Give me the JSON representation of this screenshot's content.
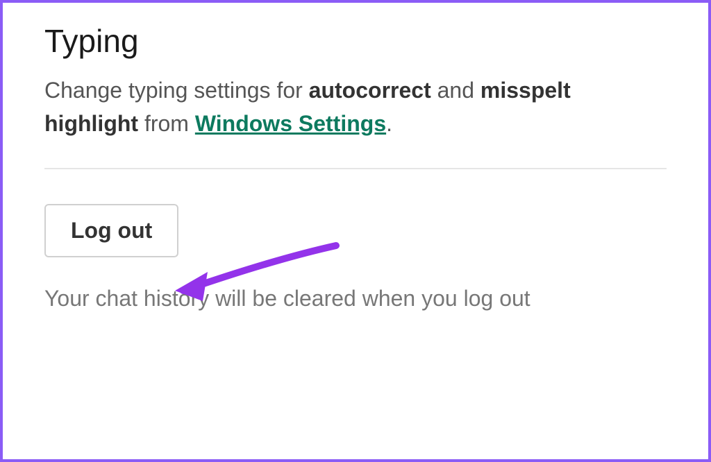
{
  "typing": {
    "title": "Typing",
    "description_prefix": "Change typing settings for ",
    "description_bold1": "autocorrect",
    "description_mid": " and ",
    "description_bold2": "misspelt highlight",
    "description_from": " from ",
    "description_link": "Windows Settings",
    "description_suffix": "."
  },
  "logout": {
    "button_label": "Log out",
    "note": "Your chat history will be cleared when you log out"
  }
}
